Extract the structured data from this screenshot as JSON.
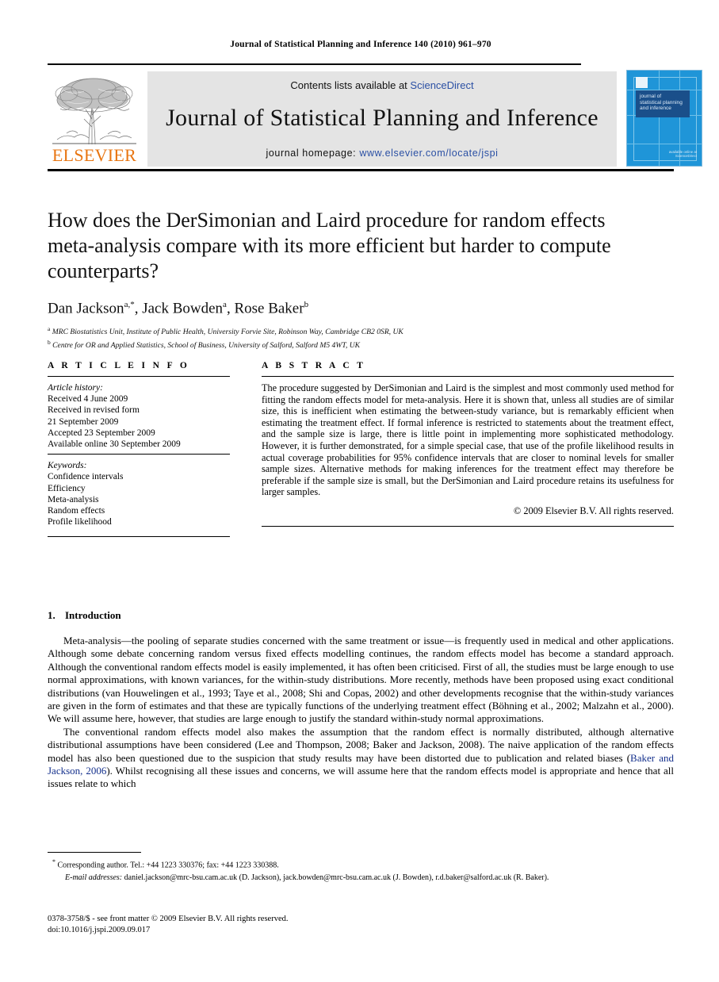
{
  "running_head": "Journal of Statistical Planning and Inference 140 (2010) 961–970",
  "masthead": {
    "publisher_name": "ELSEVIER",
    "publisher_logo_alt": "tree-engraving",
    "contents_prefix": "Contents lists available at ",
    "contents_link": "ScienceDirect",
    "journal_name": "Journal of Statistical Planning and Inference",
    "homepage_prefix": "journal homepage: ",
    "homepage_url": "www.elsevier.com/locate/jspi",
    "cover": {
      "title_line1": "journal of",
      "title_line2": "statistical planning",
      "title_line3": "and inference",
      "footer_line1": "available online at",
      "footer_line2": "ScienceDirect"
    },
    "colors": {
      "banner_bg": "#e4e4e4",
      "link_blue": "#2b50a4",
      "elsevier_orange": "#e87511",
      "cover_blue": "#1f95d8",
      "cover_title_box": "#1a4f8a"
    }
  },
  "article": {
    "title": "How does the DerSimonian and Laird procedure for random effects meta-analysis compare with its more efficient but harder to compute counterparts?",
    "authors": [
      {
        "name": "Dan Jackson",
        "marks": "a,*"
      },
      {
        "name": "Jack Bowden",
        "marks": "a"
      },
      {
        "name": "Rose Baker",
        "marks": "b"
      }
    ],
    "affiliations": [
      {
        "mark": "a",
        "text": "MRC Biostatistics Unit, Institute of Public Health, University Forvie Site, Robinson Way, Cambridge CB2 0SR, UK"
      },
      {
        "mark": "b",
        "text": "Centre for OR and Applied Statistics, School of Business, University of Salford, Salford M5 4WT, UK"
      }
    ]
  },
  "article_info": {
    "heading": "A R T I C L E   I N F O",
    "history_label": "Article history:",
    "history_lines": [
      "Received 4 June 2009",
      "Received in revised form",
      "21 September 2009",
      "Accepted 23 September 2009",
      "Available online 30 September 2009"
    ],
    "keywords_label": "Keywords:",
    "keywords": [
      "Confidence intervals",
      "Efficiency",
      "Meta-analysis",
      "Random effects",
      "Profile likelihood"
    ]
  },
  "abstract": {
    "heading": "A B S T R A C T",
    "body": "The procedure suggested by DerSimonian and Laird is the simplest and most commonly used method for fitting the random effects model for meta-analysis. Here it is shown that, unless all studies are of similar size, this is inefficient when estimating the between-study variance, but is remarkably efficient when estimating the treatment effect. If formal inference is restricted to statements about the treatment effect, and the sample size is large, there is little point in implementing more sophisticated methodology. However, it is further demonstrated, for a simple special case, that use of the profile likelihood results in actual coverage probabilities for 95% confidence intervals that are closer to nominal levels for smaller sample sizes. Alternative methods for making inferences for the treatment effect may therefore be preferable if the sample size is small, but the DerSimonian and Laird procedure retains its usefulness for larger samples.",
    "copyright": "© 2009 Elsevier B.V. All rights reserved."
  },
  "body": {
    "section_number": "1.",
    "section_title": "Introduction",
    "paragraph1_a": "Meta-analysis—the pooling of separate studies concerned with the same treatment or issue—is frequently used in medical and other applications. Although some debate concerning random versus fixed effects modelling continues, the random effects model has become a standard approach. Although the conventional random effects model is easily implemented, it has often been criticised. First of all, the studies must be large enough to use normal approximations, with known variances, for the within-study distributions. More recently, methods have been proposed using exact conditional distributions (van Houwelingen et al., 1993; Taye et al., 2008; Shi and Copas, 2002) and other developments recognise that the within-study variances are given in the form of estimates and that these are typically functions of the underlying treatment effect (Böhning et al., 2002; Malzahn et al., 2000). We will assume here, however, that studies are large enough to justify the standard within-study normal approximations.",
    "paragraph2_a": "The conventional random effects model also makes the assumption that the random effect is normally distributed, although alternative distributional assumptions have been considered (Lee and Thompson, 2008; Baker and Jackson, 2008). The naive application of the random effects model has also been questioned due to the suspicion that study results may have been distorted due to publication and related biases (",
    "paragraph2_link": "Baker and Jackson, 2006",
    "paragraph2_b": "). Whilst recognising all these issues and concerns, we will assume here that the random effects model is appropriate and hence that all issues relate to which"
  },
  "footnotes": {
    "corresponding_mark": "*",
    "corresponding": "Corresponding author. Tel.: +44 1223 330376; fax: +44 1223 330388.",
    "emails_label": "E-mail addresses:",
    "emails": "daniel.jackson@mrc-bsu.cam.ac.uk (D. Jackson), jack.bowden@mrc-bsu.cam.ac.uk (J. Bowden), r.d.baker@salford.ac.uk (R. Baker)."
  },
  "imprint": {
    "line1": "0378-3758/$ - see front matter © 2009 Elsevier B.V. All rights reserved.",
    "line2": "doi:10.1016/j.jspi.2009.09.017"
  }
}
